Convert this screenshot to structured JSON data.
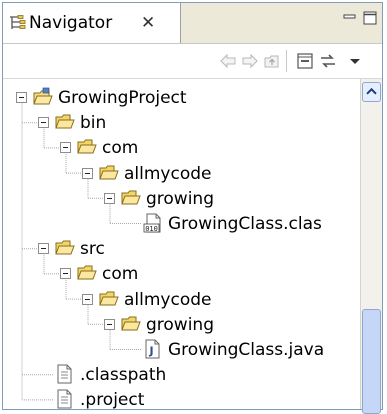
{
  "view": {
    "tab_label": "Navigator",
    "tab_close_glyph": "✕"
  },
  "toolbar": {
    "buttons": [
      "back-icon",
      "forward-icon",
      "up-folder-icon",
      "collapse-all-icon",
      "link-with-editor-icon",
      "view-menu-icon"
    ]
  },
  "tree": {
    "items": [
      {
        "label": "GrowingProject",
        "icon": "project-icon",
        "expanded": true
      },
      {
        "label": "bin",
        "icon": "open-folder-icon",
        "expanded": true
      },
      {
        "label": "com",
        "icon": "open-folder-icon",
        "expanded": true
      },
      {
        "label": "allmycode",
        "icon": "open-folder-icon",
        "expanded": true
      },
      {
        "label": "growing",
        "icon": "open-folder-icon",
        "expanded": true
      },
      {
        "label": "GrowingClass.clas",
        "icon": "class-file-icon"
      },
      {
        "label": "src",
        "icon": "open-folder-icon",
        "expanded": true
      },
      {
        "label": "com",
        "icon": "open-folder-icon",
        "expanded": true
      },
      {
        "label": "allmycode",
        "icon": "open-folder-icon",
        "expanded": true
      },
      {
        "label": "growing",
        "icon": "open-folder-icon",
        "expanded": true
      },
      {
        "label": "GrowingClass.java",
        "icon": "java-file-icon"
      },
      {
        "label": ".classpath",
        "icon": "text-file-icon"
      },
      {
        "label": ".project",
        "icon": "text-file-icon"
      }
    ]
  },
  "scrollbar": {
    "up_arrow_icon": "scroll-up-arrow-icon"
  },
  "colors": {
    "border": "#7f9db9",
    "tab_bar": "#ece9d8",
    "folder_yellow": "#f5d86a",
    "scroll_thumb": "#c6d6f6"
  }
}
